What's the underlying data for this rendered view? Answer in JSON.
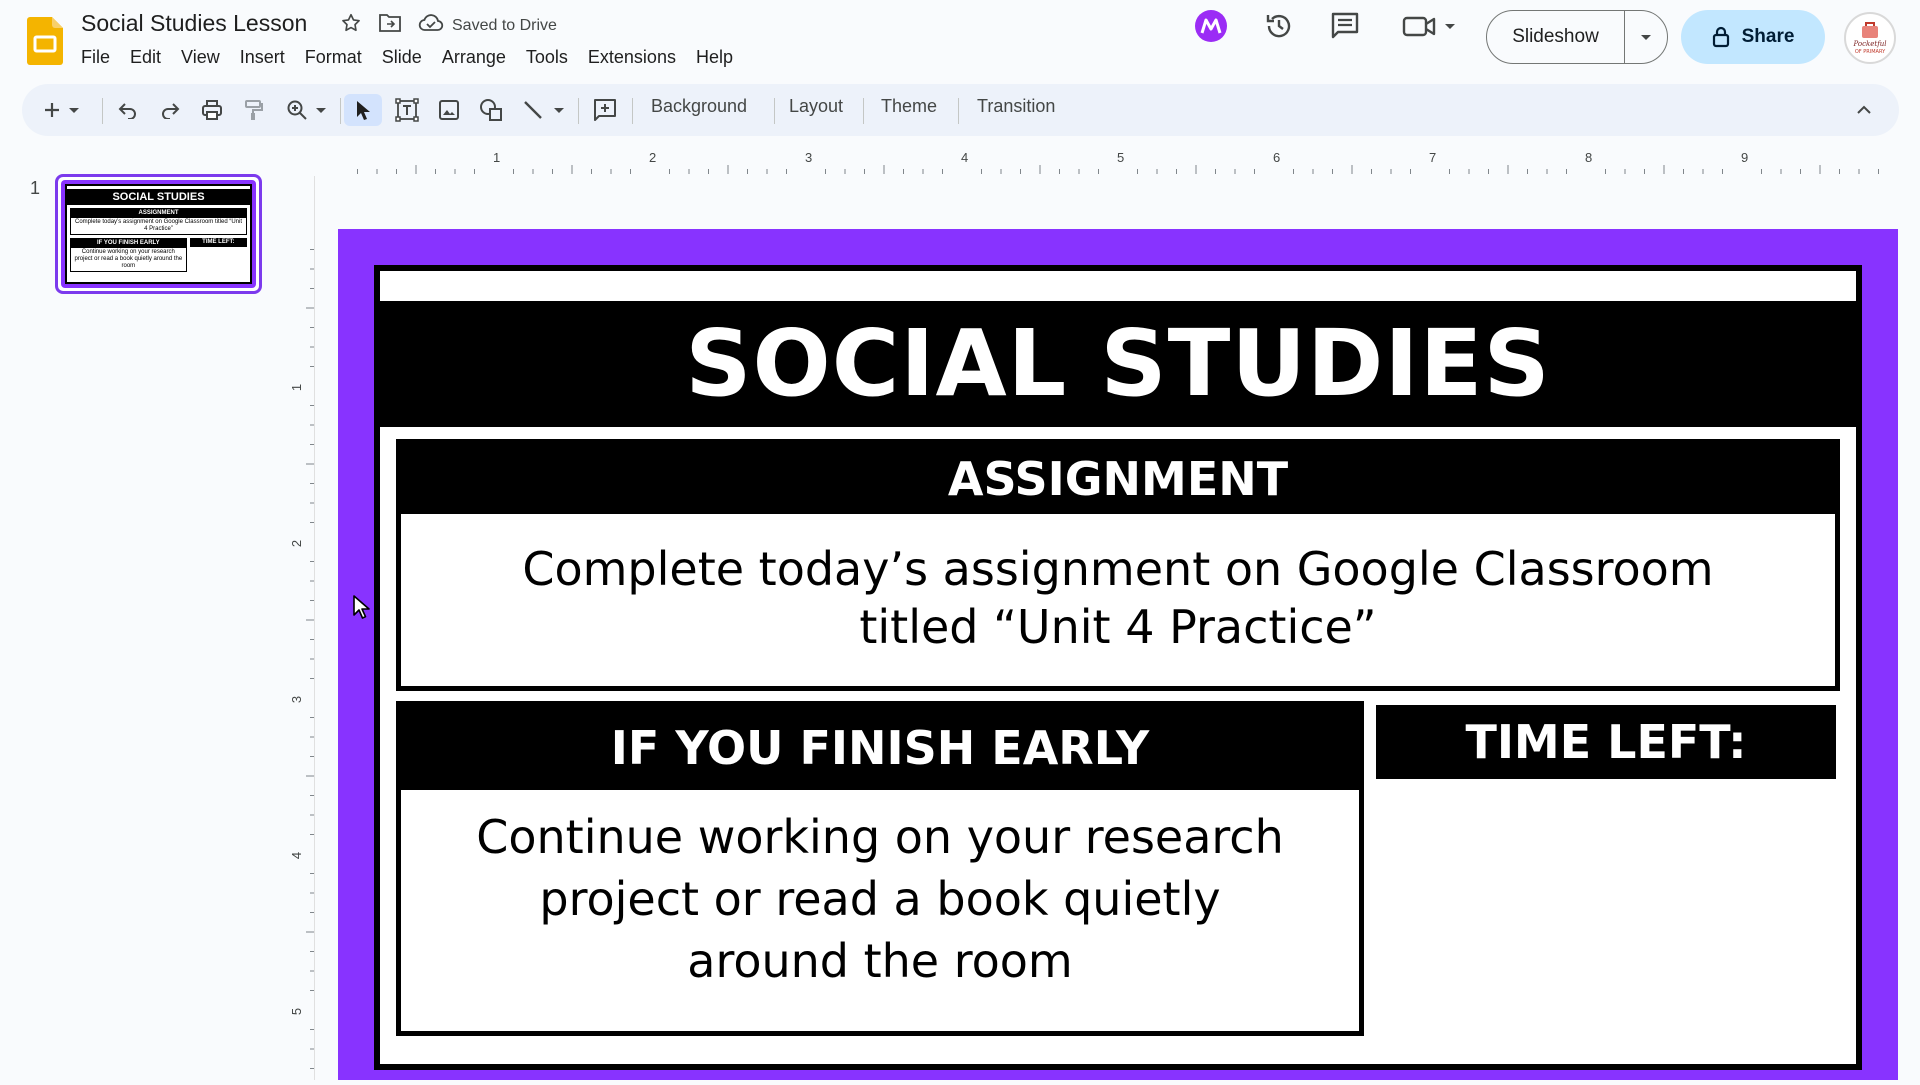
{
  "header": {
    "doc_title": "Social Studies Lesson",
    "saved_status": "Saved to Drive",
    "menu": [
      "File",
      "Edit",
      "View",
      "Insert",
      "Format",
      "Slide",
      "Arrange",
      "Tools",
      "Extensions",
      "Help"
    ],
    "slideshow_label": "Slideshow",
    "share_label": "Share",
    "avatar_text": "Pocketful of Primary"
  },
  "toolbar": {
    "background_label": "Background",
    "layout_label": "Layout",
    "theme_label": "Theme",
    "transition_label": "Transition"
  },
  "filmstrip": {
    "slide_number": "1",
    "thumb_title": "SOCIAL STUDIES",
    "thumb_assignment": "ASSIGNMENT",
    "thumb_assignment_body": "Complete today’s assignment on Google Classroom titled “Unit 4 Practice”",
    "thumb_early": "IF YOU FINISH EARLY",
    "thumb_early_body": "Continue working on your research project or read a book quietly around the room",
    "thumb_time": "TIME LEFT:"
  },
  "rulers": {
    "horizontal": [
      "1",
      "2",
      "3",
      "4",
      "5",
      "6",
      "7",
      "8",
      "9"
    ],
    "vertical": [
      "1",
      "2",
      "3",
      "4",
      "5"
    ]
  },
  "slide": {
    "title": "SOCIAL STUDIES",
    "assignment_header": "ASSIGNMENT",
    "assignment_line1": "Complete today’s assignment on Google Classroom",
    "assignment_line2": "titled “Unit 4 Practice”",
    "early_header": "IF YOU FINISH EARLY",
    "early_line1": "Continue working on your research",
    "early_line2": "project or read a book quietly",
    "early_line3": "around the room",
    "time_header": "TIME LEFT:"
  },
  "colors": {
    "slide_background": "#8833ff",
    "app_accent": "#f4b400",
    "share_bg": "#c2e7ff"
  }
}
